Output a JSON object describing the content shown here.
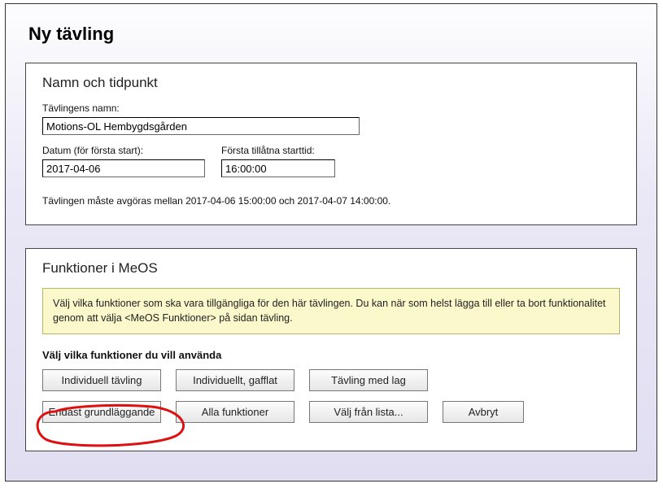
{
  "page_title": "Ny tävling",
  "panel1": {
    "title": "Namn och tidpunkt",
    "name_label": "Tävlingens namn:",
    "name_value": "Motions-OL Hembygdsgården",
    "date_label": "Datum (för första start):",
    "date_value": "2017-04-06",
    "time_label": "Första tillåtna starttid:",
    "time_value": "16:00:00",
    "note": "Tävlingen måste avgöras mellan 2017-04-06 15:00:00 och 2017-04-07 14:00:00."
  },
  "panel2": {
    "title": "Funktioner i MeOS",
    "info": "Välj vilka funktioner som ska vara tillgängliga för den här tävlingen. Du kan när som helst lägga till eller ta bort funktionalitet genom att välja <MeOS Funktioner> på sidan tävling.",
    "subheading": "Välj vilka funktioner du vill använda",
    "buttons": {
      "individual": "Individuell tävling",
      "individual_forked": "Individuellt, gafflat",
      "team": "Tävling med lag",
      "basic_only": "Endast grundläggande",
      "all": "Alla funktioner",
      "pick_list": "Välj från lista...",
      "cancel": "Avbryt"
    }
  }
}
